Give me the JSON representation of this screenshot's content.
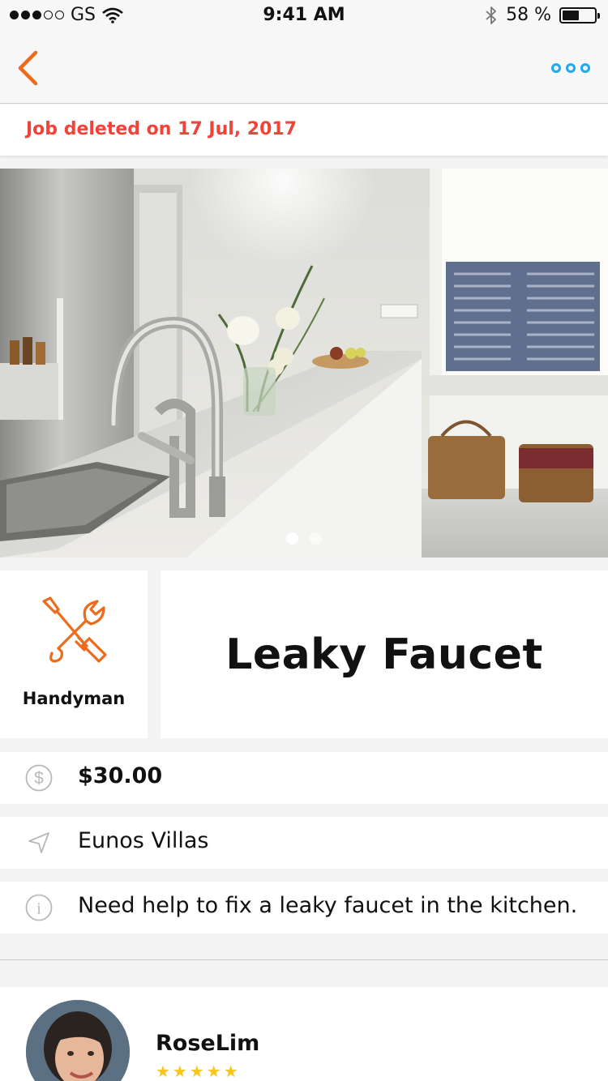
{
  "status_bar": {
    "carrier": "GS",
    "time": "9:41 AM",
    "battery_text": "58 %",
    "battery_level": 0.58
  },
  "nav": {
    "back_icon": "chevron-left-icon",
    "more_icon": "more-dots-icon"
  },
  "banner": {
    "text": "Job deleted on 17 Jul, 2017"
  },
  "photo": {
    "page_count": 2,
    "active_page": 1
  },
  "job": {
    "category": "Handyman",
    "category_icon": "tools-icon",
    "title": "Leaky Faucet",
    "price": "$30.00",
    "location": "Eunos Villas",
    "description": "Need help to fix a leaky faucet in the kitchen."
  },
  "poster": {
    "name": "RoseLim",
    "stars": "★★★★★",
    "rating": 5
  },
  "colors": {
    "accent_orange": "#ec6b1c",
    "alert_red": "#f0443a",
    "link_blue": "#1eaaf1",
    "star_yellow": "#f7c51e"
  }
}
